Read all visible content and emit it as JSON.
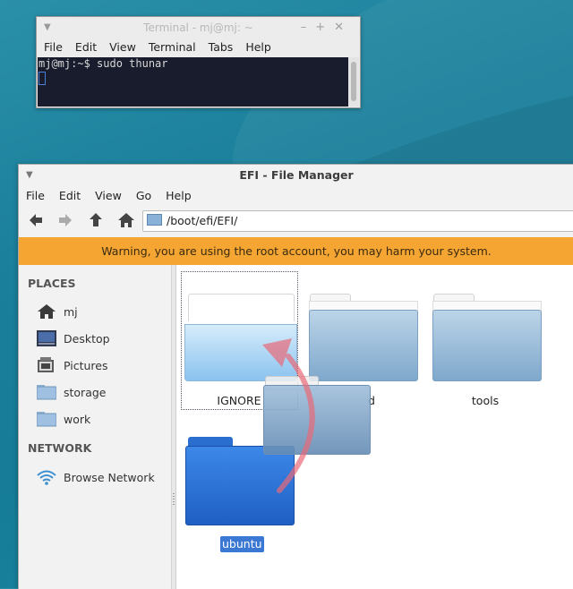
{
  "terminal": {
    "title": "Terminal - mj@mj: ~",
    "menu": [
      "File",
      "Edit",
      "View",
      "Terminal",
      "Tabs",
      "Help"
    ],
    "prompt_line": "mj@mj:~$ sudo thunar"
  },
  "file_manager": {
    "title": "EFI - File Manager",
    "menu": [
      "File",
      "Edit",
      "View",
      "Go",
      "Help"
    ],
    "location": "/boot/efi/EFI/",
    "warning": "Warning, you are using the root account, you may harm your system.",
    "sidebar": {
      "places_header": "PLACES",
      "places": [
        {
          "label": "mj",
          "icon": "home-icon"
        },
        {
          "label": "Desktop",
          "icon": "desktop-icon"
        },
        {
          "label": "Pictures",
          "icon": "pictures-icon"
        },
        {
          "label": "storage",
          "icon": "drive-icon"
        },
        {
          "label": "work",
          "icon": "folder-icon"
        }
      ],
      "network_header": "NETWORK",
      "network": [
        {
          "label": "Browse Network",
          "icon": "wifi-icon"
        }
      ]
    },
    "folders": [
      {
        "name": "IGNORE",
        "state": "drop-target"
      },
      {
        "name": "d",
        "state": "partially-hidden"
      },
      {
        "name": "tools",
        "state": "normal"
      },
      {
        "name": "ubuntu",
        "state": "selected"
      }
    ]
  },
  "colors": {
    "warning_bg": "#f4a532",
    "selection": "#3a78d4",
    "terminal_bg": "#181c2c",
    "drag_arrow": "#e86a78"
  }
}
